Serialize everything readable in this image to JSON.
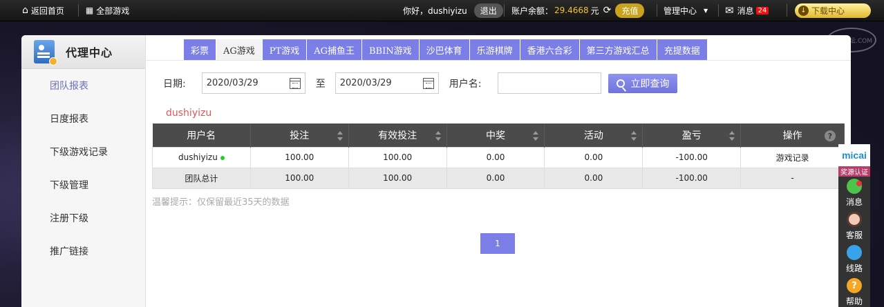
{
  "topbar": {
    "home": "返回首页",
    "all_games": "全部游戏",
    "greeting": "你好，dushiyizu",
    "logout": "退出",
    "balance_label": "账户余额：",
    "balance_value": "29.4668",
    "balance_unit": "元",
    "recharge": "充值",
    "manage_center": "管理中心",
    "messages": "消息",
    "message_count": "24",
    "download": "下载中心"
  },
  "watermark": "佳彩论坛.COM",
  "sidebar": {
    "title": "代理中心",
    "items": [
      {
        "label": "团队报表",
        "active": true
      },
      {
        "label": "日度报表"
      },
      {
        "label": "下级游戏记录"
      },
      {
        "label": "下级管理"
      },
      {
        "label": "注册下级"
      },
      {
        "label": "推广链接"
      }
    ]
  },
  "tabs": [
    {
      "label": "彩票"
    },
    {
      "label": "AG游戏",
      "active": true
    },
    {
      "label": "PT游戏"
    },
    {
      "label": "AG捕鱼王"
    },
    {
      "label": "BBIN游戏"
    },
    {
      "label": "沙巴体育"
    },
    {
      "label": "乐游棋牌"
    },
    {
      "label": "香港六合彩"
    },
    {
      "label": "第三方游戏汇总"
    },
    {
      "label": "充提数据"
    }
  ],
  "filters": {
    "date_label": "日期:",
    "start_date": "2020/03/29",
    "to_label": "至",
    "end_date": "2020/03/29",
    "username_label": "用户名:",
    "username_value": "",
    "query_button": "立即查询"
  },
  "current_user": "dushiyizu",
  "table": {
    "headers": [
      "用户名",
      "投注",
      "有效投注",
      "中奖",
      "活动",
      "盈亏",
      "操作"
    ],
    "rows": [
      [
        "dushiyizu",
        "100.00",
        "100.00",
        "0.00",
        "0.00",
        "-100.00",
        "游戏记录"
      ]
    ],
    "total": [
      "团队总计",
      "100.00",
      "100.00",
      "0.00",
      "0.00",
      "-100.00",
      "-"
    ]
  },
  "tip": "温馨提示：仅保留最近35天的数据",
  "pagination": {
    "current": "1"
  },
  "float_bar": {
    "logo": "micai",
    "verify": "奖源认证",
    "items": [
      "消息",
      "客服",
      "线路",
      "帮助"
    ]
  },
  "colors": {
    "accent": "#7a7ee6",
    "header_bg": "#4b4b4b",
    "balance": "#f1c232",
    "red": "#e25555"
  }
}
